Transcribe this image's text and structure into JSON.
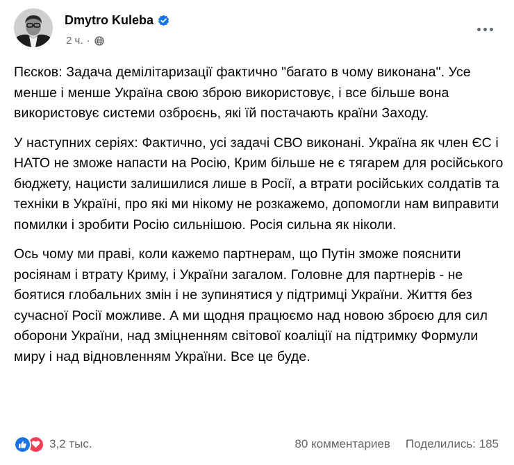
{
  "post": {
    "author": "Dmytro Kuleba",
    "time": "2 ч.",
    "separator": "·",
    "paragraphs": [
      "Пєсков: Задача демілітаризації фактично \"багато в чому виконана\". Усе менше і менше Україна свою зброю використовує, і все більше вона використовує системи озброєнь, які їй постачають країни Заходу.",
      "У наступних серіях: Фактично, усі задачі СВО виконані. Україна як член ЄС і НАТО не зможе напасти на Росію, Крим більше не є тягарем для російського бюджету, нацисти залишилися лише в Росії, а втрати російських солдатів та техніки в Україні, про які ми нікому не розкажемо, допомогли нам виправити помилки і зробити Росію сильнішою. Росія сильна як ніколи.",
      "Ось чому ми праві, коли кажемо партнерам, що Путін зможе пояснити росіянам і втрату Криму, і України загалом. Головне для партнерів - не боятися глобальних змін і не зупинятися у підтримці України. Життя без сучасної Росії можливе. А ми щодня працюємо над новою зброєю для сил оборони України, над зміцненням світової коаліції на підтримку Формули миру і над відновленням України. Все це буде."
    ]
  },
  "footer": {
    "reactions_count": "3,2 тыс.",
    "comments": "80 комментариев",
    "shares": "Поделились: 185"
  },
  "icons": {
    "verified": "verified-badge-icon",
    "privacy": "globe-icon",
    "more": "more-options-icon",
    "reactions": [
      "like-reaction-icon",
      "love-reaction-icon"
    ]
  },
  "colors": {
    "accent": "#1b74e4",
    "love": "#f33e58",
    "meta_text": "#65676b"
  }
}
